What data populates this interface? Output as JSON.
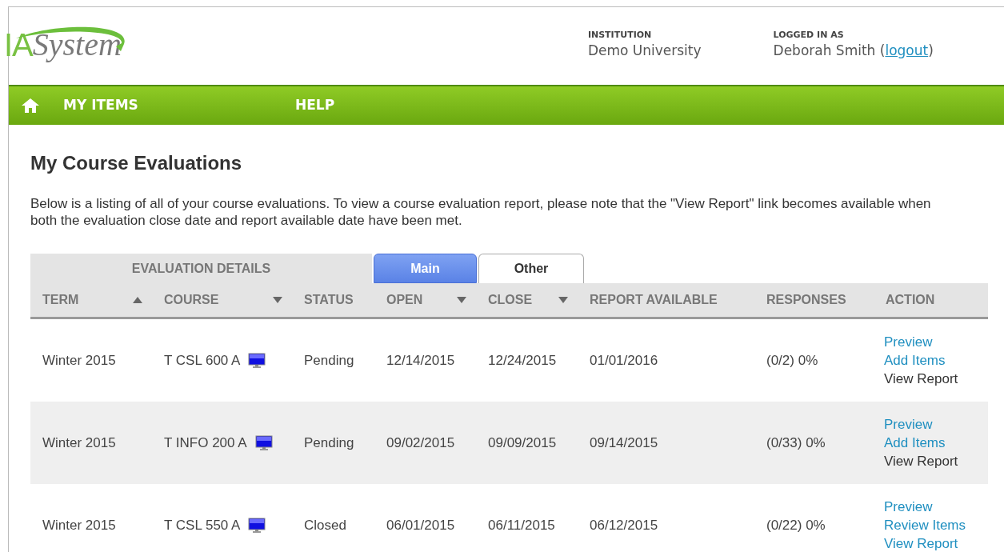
{
  "header": {
    "logo": {
      "mark": "IA",
      "name": "ystem",
      "initial": "S"
    },
    "institution": {
      "label": "INSTITUTION",
      "value": "Demo University"
    },
    "user": {
      "label": "LOGGED IN AS",
      "name": "Deborah Smith",
      "open": "(",
      "link": "logout",
      "close": ")"
    }
  },
  "nav": {
    "items": [
      {
        "label": "MY ITEMS"
      },
      {
        "label": "HELP"
      }
    ]
  },
  "page": {
    "title": "My Course Evaluations",
    "intro": "Below is a listing of all of your course evaluations. To view a course evaluation report, please note that the \"View Report\" link becomes available when both the evaluation close date and report available date have been met."
  },
  "table": {
    "group_label": "EVALUATION DETAILS",
    "tabs": [
      {
        "label": "Main",
        "selected": true
      },
      {
        "label": "Other",
        "selected": false
      }
    ],
    "columns": [
      {
        "label": "TERM",
        "kind": "sort_up"
      },
      {
        "label": "COURSE",
        "kind": "sort_down"
      },
      {
        "label": "STATUS",
        "kind": "plain"
      },
      {
        "label": "OPEN",
        "kind": "sort_down"
      },
      {
        "label": "CLOSE",
        "kind": "sort_down"
      },
      {
        "label": "REPORT AVAILABLE",
        "kind": "plain"
      },
      {
        "label": "RESPONSES",
        "kind": "plain"
      },
      {
        "label": "ACTION",
        "kind": "plain"
      }
    ],
    "rows": [
      {
        "term": "Winter 2015",
        "course": "T CSL 600 A",
        "status": "Pending",
        "open": "12/14/2015",
        "close": "12/24/2015",
        "report_available": "01/01/2016",
        "responses": "(0/2) 0%",
        "actions": [
          {
            "label": "Preview",
            "enabled": true
          },
          {
            "label": "Add Items",
            "enabled": true
          },
          {
            "label": "View Report",
            "enabled": false
          }
        ]
      },
      {
        "term": "Winter 2015",
        "course": "T INFO 200 A",
        "status": "Pending",
        "open": "09/02/2015",
        "close": "09/09/2015",
        "report_available": "09/14/2015",
        "responses": "(0/33) 0%",
        "actions": [
          {
            "label": "Preview",
            "enabled": true
          },
          {
            "label": "Add Items",
            "enabled": true
          },
          {
            "label": "View Report",
            "enabled": false
          }
        ]
      },
      {
        "term": "Winter 2015",
        "course": "T CSL 550 A",
        "status": "Closed",
        "open": "06/01/2015",
        "close": "06/11/2015",
        "report_available": "06/12/2015",
        "responses": "(0/22) 0%",
        "actions": [
          {
            "label": "Preview",
            "enabled": true
          },
          {
            "label": "Review Items",
            "enabled": true
          },
          {
            "label": "View Report",
            "enabled": true
          }
        ]
      }
    ]
  }
}
